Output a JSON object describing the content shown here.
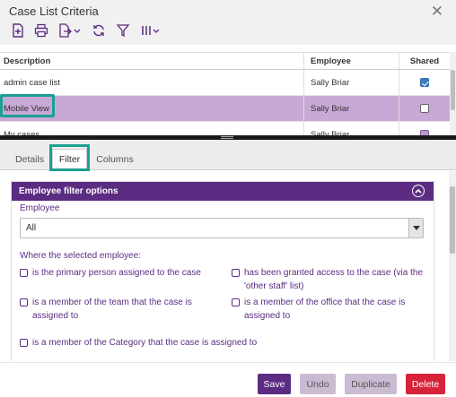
{
  "window": {
    "title": "Case List Criteria"
  },
  "toolbar": {
    "icons": [
      "new-document-icon",
      "print-icon",
      "export-icon",
      "refresh-icon",
      "filter-icon",
      "columns-icon"
    ]
  },
  "grid": {
    "columns": {
      "description": "Description",
      "employee": "Employee",
      "shared": "Shared"
    },
    "rows": [
      {
        "description": "admin case list",
        "employee": "Sally Briar",
        "shared": true,
        "selected": false
      },
      {
        "description": "Mobile View",
        "employee": "Sally Briar",
        "shared": false,
        "selected": true
      },
      {
        "description": "My cases",
        "employee": "Sally Briar",
        "shared": false,
        "selected": false
      }
    ]
  },
  "tabs": [
    {
      "label": "Details",
      "active": false
    },
    {
      "label": "Filter",
      "active": true
    },
    {
      "label": "Columns",
      "active": false
    }
  ],
  "filter_panel": {
    "title": "Employee filter options",
    "employee_label": "Employee",
    "employee_value": "All",
    "where_label": "Where the selected employee:",
    "options": [
      {
        "label": "is the primary person assigned to the case",
        "checked": false
      },
      {
        "label": "has been granted access to the case (via the 'other staff' list)",
        "checked": false
      },
      {
        "label": "is a member of the team that the case is assigned to",
        "checked": false
      },
      {
        "label": "is a member of the office that the case is assigned to",
        "checked": false
      },
      {
        "label": "is a member of the Category that the case is assigned to",
        "checked": false
      }
    ]
  },
  "footer": {
    "save_label": "Save",
    "undo_label": "Undo",
    "duplicate_label": "Duplicate",
    "delete_label": "Delete"
  },
  "colors": {
    "accent": "#5b2c82",
    "selected_row": "#c8a9d6",
    "highlight": "#1aa092",
    "delete": "#d7233a",
    "disabled_button": "#c9bcd2"
  }
}
